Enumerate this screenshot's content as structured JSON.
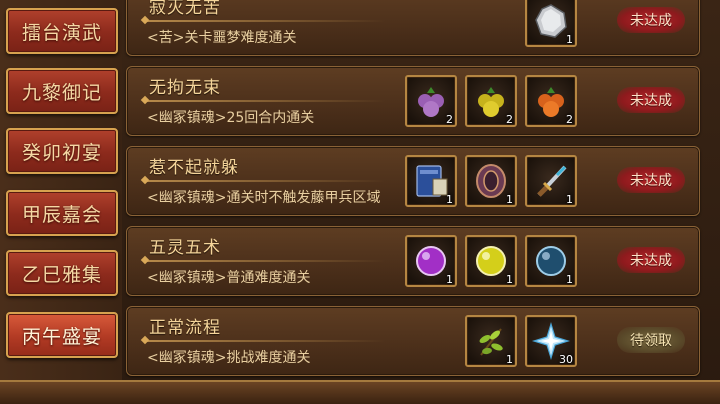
{
  "tabs": [
    {
      "label": "擂台演武",
      "active": false
    },
    {
      "label": "九黎御记",
      "active": false
    },
    {
      "label": "癸卯初宴",
      "active": false
    },
    {
      "label": "甲辰嘉会",
      "active": false
    },
    {
      "label": "乙巳雅集",
      "active": false
    },
    {
      "label": "丙午盛宴",
      "active": true
    }
  ],
  "achievements": [
    {
      "title": "寂灭无苦",
      "desc": "<苦>关卡噩梦难度通关",
      "status": "未达成",
      "status_type": "pending",
      "rewards": [
        {
          "icon": "silver-gem-icon",
          "count": "1"
        }
      ]
    },
    {
      "title": "无拘无束",
      "desc": "<幽冢镇魂>25回合内通关",
      "status": "未达成",
      "status_type": "pending",
      "rewards": [
        {
          "icon": "purple-fruit-icon",
          "count": "2"
        },
        {
          "icon": "yellow-fruit-icon",
          "count": "2"
        },
        {
          "icon": "orange-fruit-icon",
          "count": "2"
        }
      ]
    },
    {
      "title": "惹不起就躲",
      "desc": "<幽冢镇魂>通关时不触发藤甲兵区域",
      "status": "未达成",
      "status_type": "pending",
      "rewards": [
        {
          "icon": "blue-book-icon",
          "count": "1"
        },
        {
          "icon": "scroll-icon",
          "count": "1"
        },
        {
          "icon": "dagger-icon",
          "count": "1"
        }
      ]
    },
    {
      "title": "五灵五术",
      "desc": "<幽冢镇魂>普通难度通关",
      "status": "未达成",
      "status_type": "pending",
      "rewards": [
        {
          "icon": "purple-orb-icon",
          "count": "1"
        },
        {
          "icon": "yellow-orb-icon",
          "count": "1"
        },
        {
          "icon": "blue-orb-icon",
          "count": "1"
        }
      ]
    },
    {
      "title": "正常流程",
      "desc": "<幽冢镇魂>挑战难度通关",
      "status": "待领取",
      "status_type": "claim",
      "rewards": [
        {
          "icon": "herb-icon",
          "count": "1"
        },
        {
          "icon": "ice-crystal-icon",
          "count": "30"
        }
      ]
    }
  ]
}
